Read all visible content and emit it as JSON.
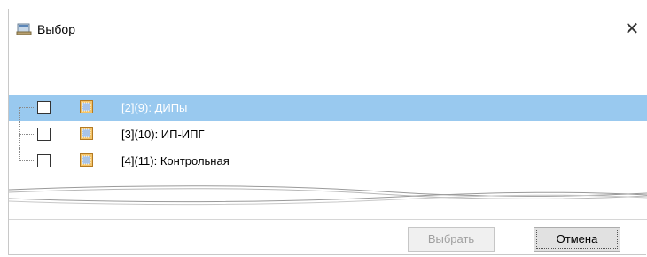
{
  "window": {
    "title": "Выбор",
    "close_glyph": "✕",
    "icon": "app-window-icon"
  },
  "tree": {
    "items": [
      {
        "label": "[2](9): ДИПы",
        "checked": false,
        "selected": true,
        "icon": "node-icon"
      },
      {
        "label": "[3](10): ИП-ИПГ",
        "checked": false,
        "selected": false,
        "icon": "node-icon"
      },
      {
        "label": "[4](11): Контрольная",
        "checked": false,
        "selected": false,
        "icon": "node-icon"
      }
    ]
  },
  "buttons": {
    "select_label": "Выбрать",
    "select_enabled": false,
    "cancel_label": "Отмена"
  },
  "colors": {
    "selection": "#99c9ef",
    "disabled_text": "#a0a0a0"
  }
}
